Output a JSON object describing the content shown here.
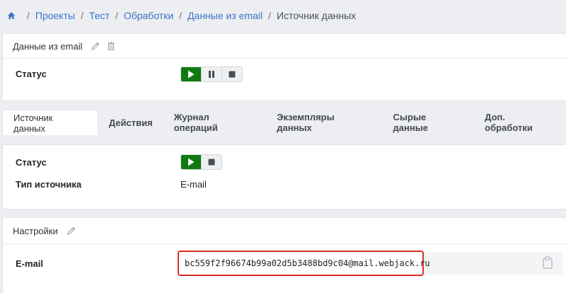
{
  "breadcrumb": {
    "items": [
      "Проекты",
      "Тест",
      "Обработки",
      "Данные из email"
    ],
    "current": "Источник данных"
  },
  "top_card": {
    "title": "Данные из email",
    "status_label": "Статус"
  },
  "tabs": [
    {
      "label": "Источник данных",
      "active": true
    },
    {
      "label": "Действия"
    },
    {
      "label": "Журнал операций"
    },
    {
      "label": "Экземпляры данных"
    },
    {
      "label": "Сырые данные"
    },
    {
      "label": "Доп. обработки"
    }
  ],
  "source_card": {
    "status_label": "Статус",
    "type_label": "Тип источника",
    "type_value": "E-mail"
  },
  "settings_card": {
    "title": "Настройки",
    "email_label": "E-mail",
    "email_value": "bc559f2f96674b99a02d5b3488bd9c04@mail.webjack.ru"
  },
  "colors": {
    "play_green": "#0f7a0f",
    "link_blue": "#3a74c9",
    "highlight_red": "#d93025"
  }
}
